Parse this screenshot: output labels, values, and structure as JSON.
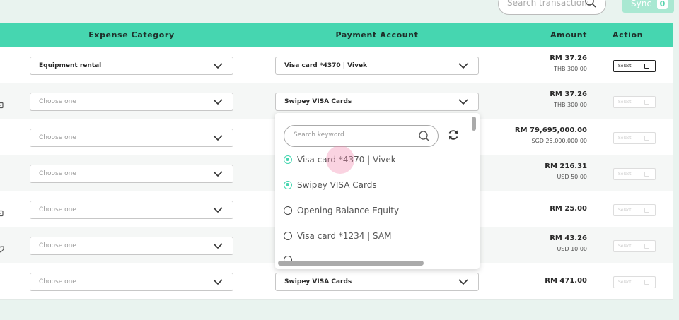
{
  "search": {
    "placeholder": "Search transactions"
  },
  "sync": {
    "label": "Sync",
    "count": "0"
  },
  "columns": {
    "category": "Expense Category",
    "payment": "Payment Account",
    "amount": "Amount",
    "action": "Action"
  },
  "rows": [
    {
      "category": "Equipment rental",
      "payment": "Visa card *4370 | Vivek",
      "amount": "RM 37.26",
      "sub": "THB 300.00",
      "action": "Select"
    },
    {
      "category": "Choose one",
      "payment": "Swipey VISA Cards",
      "amount": "RM 37.26",
      "sub": "THB 300.00",
      "action": "Select"
    },
    {
      "category": "Choose one",
      "payment": "",
      "amount": "RM 79,695,000.00",
      "sub": "SGD 25,000,000.00",
      "action": "Select"
    },
    {
      "category": "Choose one",
      "payment": "",
      "amount": "RM 216.31",
      "sub": "USD 50.00",
      "action": "Select"
    },
    {
      "category": "Choose one",
      "payment": "",
      "amount": "RM 25.00",
      "sub": "",
      "action": "Select"
    },
    {
      "category": "Choose one",
      "payment": "",
      "amount": "RM 43.26",
      "sub": "USD 10.00",
      "action": "Select"
    },
    {
      "category": "Choose one",
      "payment": "Swipey VISA Cards",
      "amount": "RM 471.00",
      "sub": "",
      "action": "Select"
    }
  ],
  "dropdown": {
    "search_placeholder": "Search keyword",
    "options": [
      {
        "label": "Visa card *4370 | Vivek",
        "selected": true
      },
      {
        "label": "Swipey VISA Cards",
        "selected": true
      },
      {
        "label": "Opening Balance Equity",
        "selected": false
      },
      {
        "label": "Visa card *1234 | SAM",
        "selected": false
      }
    ]
  },
  "icons": {
    "search": "search-icon",
    "chevron": "chevron-down-icon",
    "refresh": "refresh-icon",
    "checkbox": "checkbox-icon"
  },
  "colors": {
    "accent": "#46d6b0",
    "accent_light": "#a9e8d2",
    "background": "#e9f3ef"
  }
}
